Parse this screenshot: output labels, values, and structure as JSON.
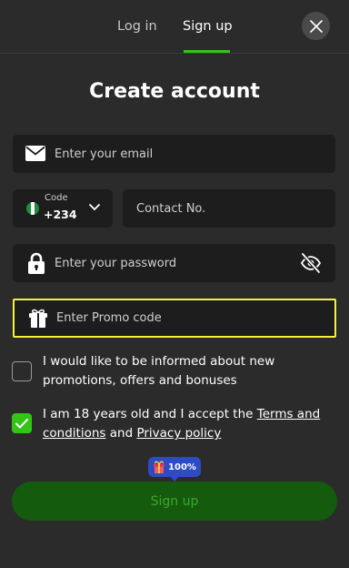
{
  "tabs": {
    "login_label": "Log in",
    "signup_label": "Sign up"
  },
  "title": "Create account",
  "email": {
    "placeholder": "Enter your email"
  },
  "phone": {
    "code_label": "Code",
    "code_value": "+234",
    "contact_placeholder": "Contact No."
  },
  "password": {
    "placeholder": "Enter your password"
  },
  "promo": {
    "placeholder": "Enter Promo code"
  },
  "checkboxes": {
    "marketing": {
      "text": "I would like to be informed about new promotions, offers and bonuses",
      "checked": false
    },
    "terms": {
      "text_before": "I am 18 years old and I accept the ",
      "terms_link": "Terms and conditions",
      "text_middle": " and ",
      "privacy_link": "Privacy policy",
      "checked": true
    }
  },
  "badge": {
    "label": "100%"
  },
  "submit": {
    "label": "Sign up"
  },
  "colors": {
    "background": "#2b2b2b",
    "field": "#1d1d1d",
    "accent_green": "#34c418",
    "button_green": "#145b0e",
    "highlight": "#f4f236",
    "badge": "#2d4bc2"
  },
  "icons": {
    "close": "close-icon",
    "email": "envelope-icon",
    "flag": "nigeria-flag-icon",
    "chevron": "chevron-down-icon",
    "password": "lock-icon",
    "visibility": "eye-slash-icon",
    "promo": "gift-icon",
    "check": "checkmark-icon",
    "badge": "gift-box-icon"
  }
}
